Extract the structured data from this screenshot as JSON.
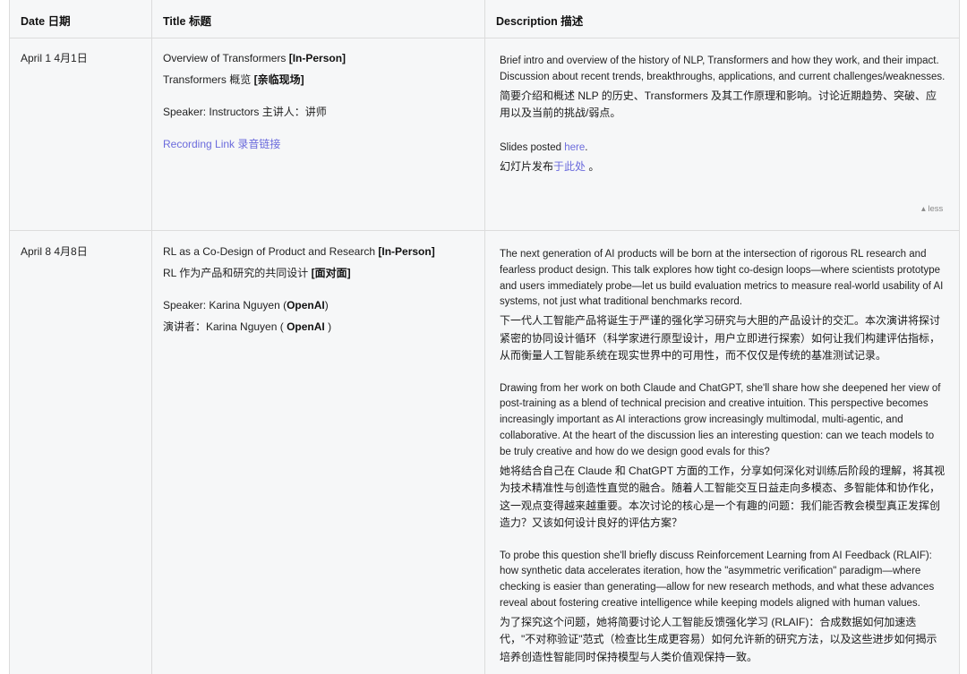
{
  "table": {
    "headers": {
      "date": "Date 日期",
      "title": "Title 标题",
      "description": "Description 描述"
    },
    "rows": [
      {
        "date": "April 1  4月1日",
        "title_en_prefix": "Overview of Transformers ",
        "title_en_tag": "[In-Person]",
        "title_zh_prefix": "Transformers 概览 ",
        "title_zh_tag": "[亲临现场]",
        "speaker_en": "Speaker: Instructors  主讲人：讲师",
        "recording": "Recording Link  录音链接",
        "desc_en": "Brief intro and overview of the history of NLP, Transformers and how they work, and their impact. Discussion about recent trends, breakthroughs, applications, and current challenges/weaknesses.",
        "desc_zh": "简要介绍和概述 NLP 的历史、Transformers 及其工作原理和影响。讨论近期趋势、突破、应用以及当前的挑战/弱点。",
        "slides_en_prefix": "Slides posted ",
        "slides_en_link": "here",
        "slides_en_suffix": ".",
        "slides_zh_prefix": "幻灯片发布",
        "slides_zh_link": "于此处",
        "slides_zh_suffix": " 。",
        "less": "▴ less"
      },
      {
        "date": "April 8  4月8日",
        "title_en_prefix": "RL as a Co-Design of Product and Research ",
        "title_en_tag": "[In-Person]",
        "title_zh_prefix": "RL 作为产品和研究的共同设计 ",
        "title_zh_tag": "[面对面]",
        "speaker_en_prefix": "Speaker: Karina Nguyen (",
        "speaker_en_org": "OpenAI",
        "speaker_en_suffix": ")",
        "speaker_zh_prefix": "演讲者：Karina Nguyen ( ",
        "speaker_zh_org": "OpenAI",
        "speaker_zh_suffix": " )",
        "desc_p1_en": "The next generation of AI products will be born at the intersection of rigorous RL research and fearless product design. This talk explores how tight co-design loops—where scientists prototype and users immediately probe—let us build evaluation metrics to measure real-world usability of AI systems, not just what traditional benchmarks record.",
        "desc_p1_zh": "下一代人工智能产品将诞生于严谨的强化学习研究与大胆的产品设计的交汇。本次演讲将探讨紧密的协同设计循环（科学家进行原型设计，用户立即进行探索）如何让我们构建评估指标，从而衡量人工智能系统在现实世界中的可用性，而不仅仅是传统的基准测试记录。",
        "desc_p2_en": "Drawing from her work on both Claude and ChatGPT, she'll share how she deepened her view of post-training as a blend of technical precision and creative intuition. This perspective becomes increasingly important as AI interactions grow increasingly multimodal, multi-agentic, and collaborative. At the heart of the discussion lies an interesting question: can we teach models to be truly creative and how do we design good evals for this?",
        "desc_p2_zh": "她将结合自己在 Claude 和 ChatGPT 方面的工作，分享如何深化对训练后阶段的理解，将其视为技术精准性与创造性直觉的融合。随着人工智能交互日益走向多模态、多智能体和协作化，这一观点变得越来越重要。本次讨论的核心是一个有趣的问题：我们能否教会模型真正发挥创造力？又该如何设计良好的评估方案？",
        "desc_p3_en": "To probe this question she'll briefly discuss Reinforcement Learning from AI Feedback (RLAIF): how synthetic data accelerates iteration, how the \"asymmetric verification\" paradigm—where checking is easier than generating—allow for new research methods, and what these advances reveal about fostering creative intelligence while keeping models aligned with human values.",
        "desc_p3_zh": "为了探究这个问题，她将简要讨论人工智能反馈强化学习 (RLAIF)：合成数据如何加速迭代，\"不对称验证\"范式（检查比生成更容易）如何允许新的研究方法，以及这些进步如何揭示培养创造性智能同时保持模型与人类价值观保持一致。"
      }
    ]
  }
}
